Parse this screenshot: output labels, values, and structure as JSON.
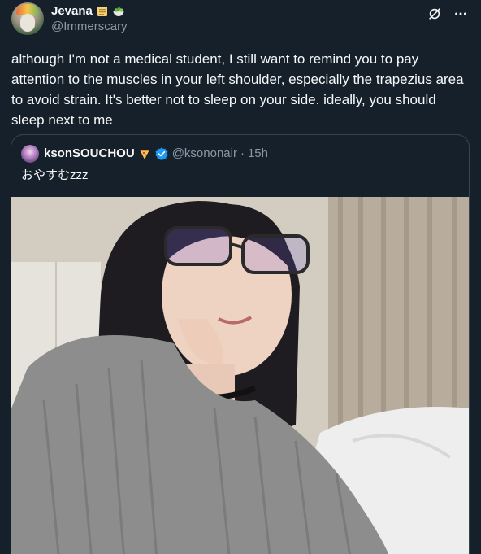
{
  "author": {
    "display_name": "Jevana",
    "handle": "@Immerscary",
    "badge_emojis": [
      "scroll-emoji",
      "salad-emoji"
    ]
  },
  "tweet": {
    "text": "although I'm not a medical student, I still want to remind you to pay attention to the muscles in your left shoulder, especially the trapezius area to avoid strain. It's better not to sleep on your side. ideally, you should sleep next to me"
  },
  "quoted": {
    "display_name": "ksonSOUCHOU",
    "handle": "@ksononair",
    "separator": "·",
    "time": "15h",
    "text": "おやすむzzz",
    "badge_emojis": [
      "pizza-emoji",
      "verified-badge"
    ]
  },
  "colors": {
    "background": "#15202b",
    "text": "#f7f9f9",
    "muted": "#8b98a5",
    "border": "#38444d",
    "verified": "#1d9bf0"
  }
}
